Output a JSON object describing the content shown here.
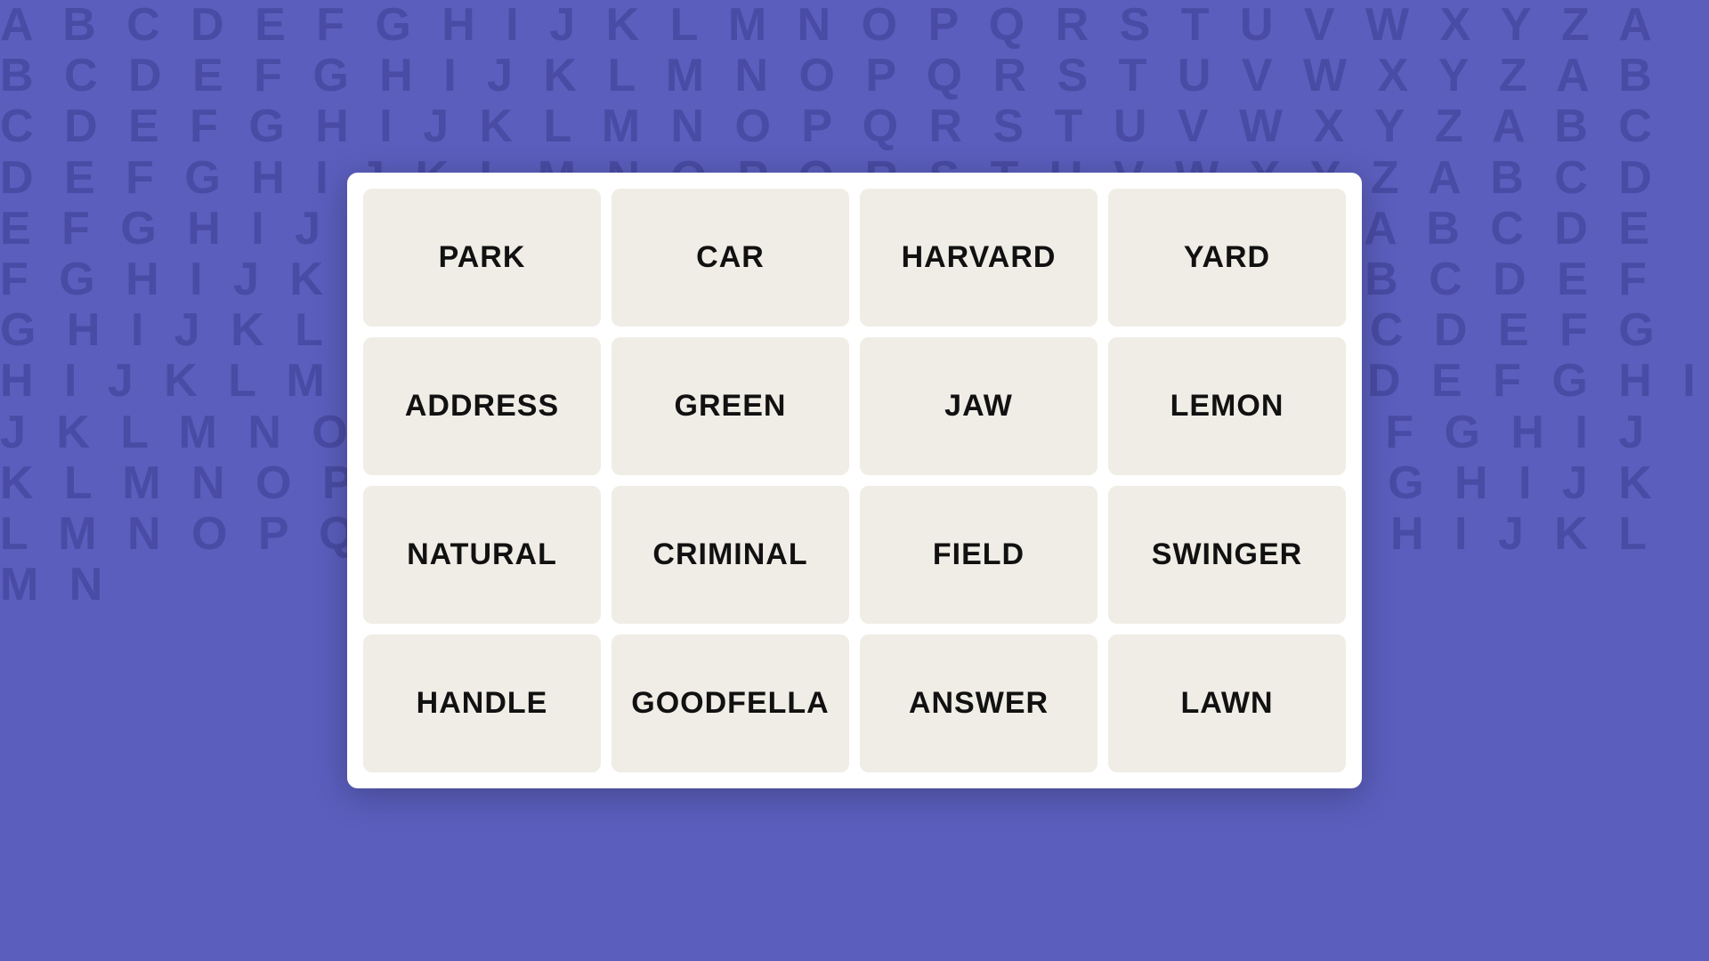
{
  "background": {
    "letters": "ABCDEFGHIJKLMNOPQRSTUVWXYZ"
  },
  "board": {
    "cards": [
      {
        "id": "park",
        "label": "PARK"
      },
      {
        "id": "car",
        "label": "CAR"
      },
      {
        "id": "harvard",
        "label": "HARVARD"
      },
      {
        "id": "yard",
        "label": "YARD"
      },
      {
        "id": "address",
        "label": "ADDRESS"
      },
      {
        "id": "green",
        "label": "GREEN"
      },
      {
        "id": "jaw",
        "label": "JAW"
      },
      {
        "id": "lemon",
        "label": "LEMON"
      },
      {
        "id": "natural",
        "label": "NATURAL"
      },
      {
        "id": "criminal",
        "label": "CRIMINAL"
      },
      {
        "id": "field",
        "label": "FIELD"
      },
      {
        "id": "swinger",
        "label": "SWINGER"
      },
      {
        "id": "handle",
        "label": "HANDLE"
      },
      {
        "id": "goodfella",
        "label": "GOODFELLA"
      },
      {
        "id": "answer",
        "label": "ANSWER"
      },
      {
        "id": "lawn",
        "label": "LAWN"
      }
    ]
  }
}
